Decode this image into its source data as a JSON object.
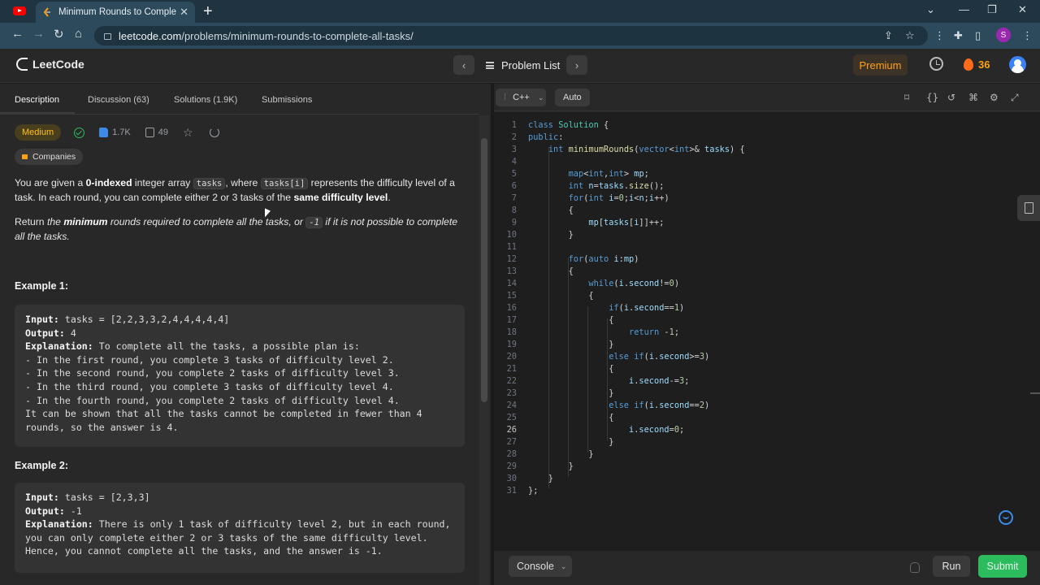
{
  "browser": {
    "tab_title": "Minimum Rounds to Complete A",
    "tab_close": "✕",
    "new_tab": "+",
    "url_host": "leetcode.com",
    "url_path": "/problems/minimum-rounds-to-complete-all-tasks/",
    "profile_initial": "S",
    "win_min": "⌄",
    "win_dash": "—",
    "win_max": "❐",
    "win_close": "✕"
  },
  "header": {
    "logo": "LeetCode",
    "problem_list": "Problem List",
    "prev": "‹",
    "next": "›",
    "premium": "Premium",
    "streak": "36"
  },
  "tabs": [
    {
      "label": "Description"
    },
    {
      "label": "Discussion (63)"
    },
    {
      "label": "Solutions (1.9K)"
    },
    {
      "label": "Submissions"
    }
  ],
  "problem": {
    "difficulty": "Medium",
    "likes": "1.7K",
    "dislikes": "49",
    "companies": "Companies",
    "p1_a": "You are given a ",
    "p1_b": "0-indexed",
    "p1_c": " integer array ",
    "p1_code1": "tasks",
    "p1_d": ", where ",
    "p1_code2": "tasks[i]",
    "p1_e": " represents the difficulty level of a task. In each round, you can complete either 2 or 3 tasks of the ",
    "p1_f": "same difficulty level",
    "p1_g": ".",
    "p2_a": "Return ",
    "p2_b": "the ",
    "p2_c": "minimum",
    "p2_d": " rounds required to complete all the tasks, or ",
    "p2_code": "-1",
    "p2_e": " if it is not possible to complete all the tasks."
  },
  "example1": {
    "heading": "Example 1:",
    "input_label": "Input:",
    "input_value": " tasks = [2,2,3,3,2,4,4,4,4,4]",
    "output_label": "Output:",
    "output_value": " 4",
    "explanation_label": "Explanation:",
    "explanation_first": " To complete all the tasks, a possible plan is:",
    "explanation_rest": "- In the first round, you complete 3 tasks of difficulty level 2.\n- In the second round, you complete 2 tasks of difficulty level 3.\n- In the third round, you complete 3 tasks of difficulty level 4.\n- In the fourth round, you complete 2 tasks of difficulty level 4.\nIt can be shown that all the tasks cannot be completed in fewer than 4\nrounds, so the answer is 4."
  },
  "example2": {
    "heading": "Example 2:",
    "input_label": "Input:",
    "input_value": " tasks = [2,3,3]",
    "output_label": "Output:",
    "output_value": " -1",
    "explanation_label": "Explanation:",
    "explanation_first": " There is only 1 task of difficulty level 2, but in each round,",
    "explanation_rest": "you can only complete either 2 or 3 tasks of the same difficulty level.\nHence, you cannot complete all the tasks, and the answer is -1."
  },
  "editor": {
    "language": "C++",
    "mode": "Auto",
    "current_line": 26,
    "lines": [
      "class Solution {",
      "public:",
      "    int minimumRounds(vector<int>& tasks) {",
      "",
      "        map<int,int> mp;",
      "        int n=tasks.size();",
      "        for(int i=0;i<n;i++)",
      "        {",
      "            mp[tasks[i]]++;",
      "        }",
      "",
      "        for(auto i:mp)",
      "        {",
      "            while(i.second!=0)",
      "            {",
      "                if(i.second==1)",
      "                {",
      "                    return -1;",
      "                }",
      "                else if(i.second>=3)",
      "                {",
      "                    i.second-=3;",
      "                }",
      "                else if(i.second==2)",
      "                {",
      "                    i.second=0;",
      "                }",
      "            }",
      "        }",
      "    }",
      "};"
    ]
  },
  "bottom": {
    "console": "Console",
    "run": "Run",
    "submit": "Submit"
  }
}
